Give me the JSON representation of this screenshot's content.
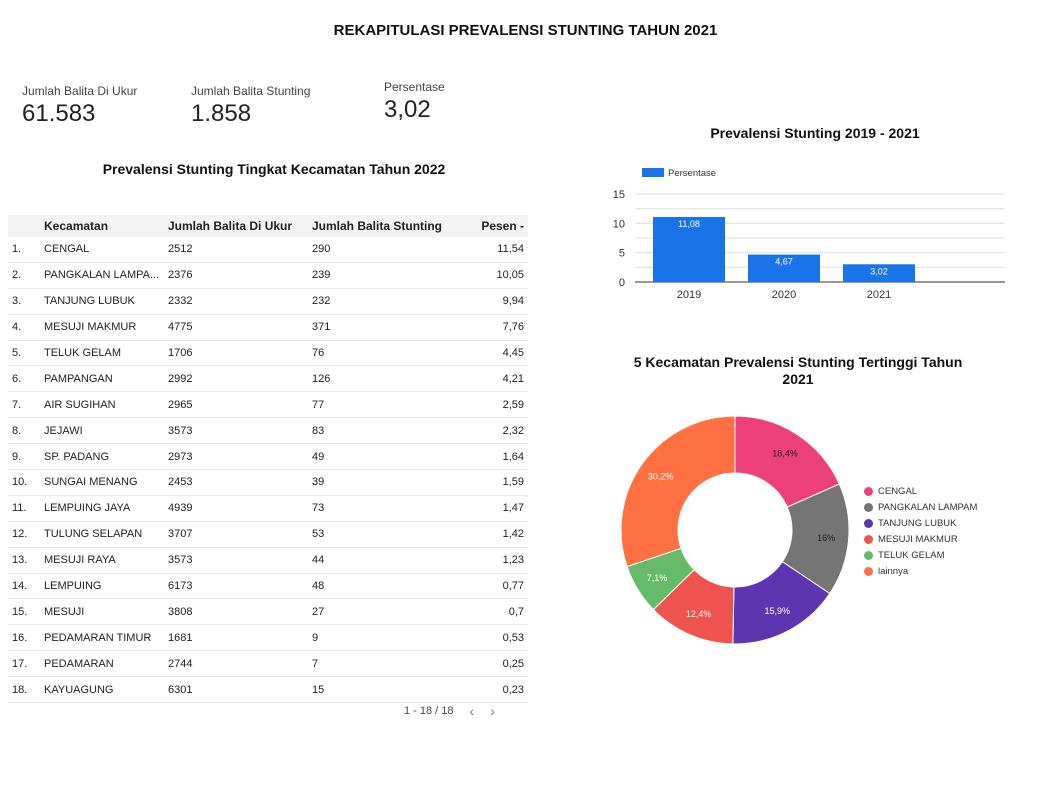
{
  "title": "REKAPITULASI PREVALENSI STUNTING TAHUN 2021",
  "kpis": [
    {
      "label": "Jumlah Balita Di Ukur",
      "value": "61.583"
    },
    {
      "label": "Jumlah Balita Stunting",
      "value": "1.858"
    },
    {
      "label": "Persentase",
      "value": "3,02"
    }
  ],
  "table": {
    "title": "Prevalensi Stunting Tingkat Kecamatan Tahun 2022",
    "headers": [
      "",
      "Kecamatan",
      "Jumlah Balita Di Ukur",
      "Jumlah Balita Stunting",
      "Pesen -"
    ],
    "rows": [
      [
        "1.",
        "CENGAL",
        "2512",
        "290",
        "11,54"
      ],
      [
        "2.",
        "PANGKALAN LAMPA...",
        "2376",
        "239",
        "10,05"
      ],
      [
        "3.",
        "TANJUNG LUBUK",
        "2332",
        "232",
        "9,94"
      ],
      [
        "4.",
        "MESUJI MAKMUR",
        "4775",
        "371",
        "7,76"
      ],
      [
        "5.",
        "TELUK GELAM",
        "1706",
        "76",
        "4,45"
      ],
      [
        "6.",
        "PAMPANGAN",
        "2992",
        "126",
        "4,21"
      ],
      [
        "7.",
        "AIR SUGIHAN",
        "2965",
        "77",
        "2,59"
      ],
      [
        "8.",
        "JEJAWI",
        "3573",
        "83",
        "2,32"
      ],
      [
        "9.",
        "SP. PADANG",
        "2973",
        "49",
        "1,64"
      ],
      [
        "10.",
        "SUNGAI MENANG",
        "2453",
        "39",
        "1,59"
      ],
      [
        "11.",
        "LEMPUING JAYA",
        "4939",
        "73",
        "1,47"
      ],
      [
        "12.",
        "TULUNG SELAPAN",
        "3707",
        "53",
        "1,42"
      ],
      [
        "13.",
        "MESUJI RAYA",
        "3573",
        "44",
        "1,23"
      ],
      [
        "14.",
        "LEMPUING",
        "6173",
        "48",
        "0,77"
      ],
      [
        "15.",
        "MESUJI",
        "3808",
        "27",
        "0,7"
      ],
      [
        "16.",
        "PEDAMARAN TIMUR",
        "1681",
        "9",
        "0,53"
      ],
      [
        "17.",
        "PEDAMARAN",
        "2744",
        "7",
        "0,25"
      ],
      [
        "18.",
        "KAYUAGUNG",
        "6301",
        "15",
        "0,23"
      ]
    ],
    "pagination": {
      "text": "1 - 18 / 18",
      "prev": "‹",
      "next": "›"
    }
  },
  "chart_data": [
    {
      "type": "bar",
      "title": "Prevalensi Stunting 2019 - 2021",
      "categories": [
        "2019",
        "2020",
        "2021"
      ],
      "series": [
        {
          "name": "Persentase",
          "values": [
            11.08,
            4.67,
            3.02
          ],
          "labels": [
            "11,08",
            "4,67",
            "3,02"
          ]
        }
      ],
      "ylim": [
        0,
        15
      ],
      "yticks": [
        "0",
        "5",
        "10",
        "15"
      ],
      "grid": true,
      "legend": "top-left",
      "color": "#1a73e8"
    },
    {
      "type": "pie",
      "title": "5 Kecamatan Prevalensi Stunting Tertinggi Tahun 2021",
      "donut": true,
      "legend": "right",
      "slices": [
        {
          "name": "CENGAL",
          "value": 18.4,
          "label": "18,4%",
          "color": "#ec407a"
        },
        {
          "name": "PANGKALAN LAMPAM",
          "value": 16,
          "label": "16%",
          "color": "#757575"
        },
        {
          "name": "TANJUNG LUBUK",
          "value": 15.9,
          "label": "15,9%",
          "color": "#5e35b1"
        },
        {
          "name": "MESUJI MAKMUR",
          "value": 12.4,
          "label": "12,4%",
          "color": "#ef5350"
        },
        {
          "name": "TELUK GELAM",
          "value": 7.1,
          "label": "7,1%",
          "color": "#66bb6a"
        },
        {
          "name": "lainnya",
          "value": 30.2,
          "label": "30,2%",
          "color": "#ff7043"
        }
      ]
    }
  ]
}
